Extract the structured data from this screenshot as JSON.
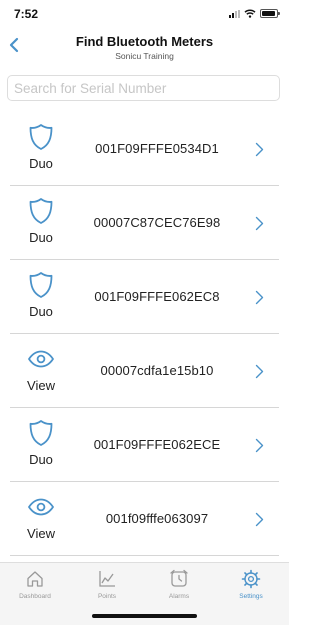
{
  "status_bar": {
    "time": "7:52"
  },
  "header": {
    "title": "Find Bluetooth Meters",
    "subtitle": "Sonicu Training"
  },
  "search": {
    "placeholder": "Search for Serial Number",
    "value": ""
  },
  "meters": [
    {
      "type": "Duo",
      "icon": "shield-icon",
      "serial": "001F09FFFE0534D1"
    },
    {
      "type": "Duo",
      "icon": "shield-icon",
      "serial": "00007C87CEC76E98"
    },
    {
      "type": "Duo",
      "icon": "shield-icon",
      "serial": "001F09FFFE062EC8"
    },
    {
      "type": "View",
      "icon": "eye-icon",
      "serial": "00007cdfa1e15b10"
    },
    {
      "type": "Duo",
      "icon": "shield-icon",
      "serial": "001F09FFFE062ECE"
    },
    {
      "type": "View",
      "icon": "eye-icon",
      "serial": "001f09fffe063097"
    }
  ],
  "tabs": [
    {
      "label": "Dashboard",
      "icon": "home-icon",
      "active": false
    },
    {
      "label": "Points",
      "icon": "chart-icon",
      "active": false
    },
    {
      "label": "Alarms",
      "icon": "alarm-clock-icon",
      "active": false
    },
    {
      "label": "Settings",
      "icon": "gear-icon",
      "active": true
    }
  ],
  "colors": {
    "accent": "#4a92c9",
    "inactive": "#999999",
    "divider": "#d6d6d6"
  }
}
